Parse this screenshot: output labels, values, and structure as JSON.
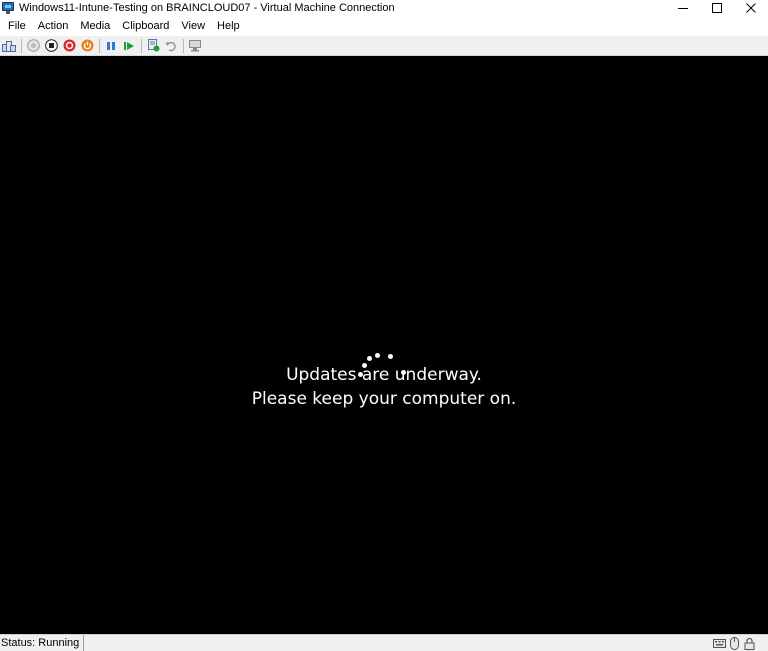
{
  "window": {
    "title": "Windows11-Intune-Testing on BRAINCLOUD07 - Virtual Machine Connection"
  },
  "menu": {
    "items": [
      "File",
      "Action",
      "Media",
      "Clipboard",
      "View",
      "Help"
    ]
  },
  "toolbar": {
    "icons": [
      "ctrl-alt-del-icon",
      "start-icon",
      "turn-off-icon",
      "shut-down-icon",
      "save-icon",
      "pause-icon",
      "resume-icon",
      "checkpoint-icon",
      "revert-icon",
      "enhanced-session-icon"
    ]
  },
  "vm": {
    "message_line1": "Updates are underway.",
    "message_line2": "Please keep your computer on."
  },
  "status": {
    "text": "Status: Running"
  },
  "colors": {
    "vm_background": "#000000",
    "message_text": "#ffffff",
    "shutdown_red": "#d9262c",
    "save_orange": "#e8811b",
    "pause_blue": "#2a7ad4",
    "resume_green": "#1e9e3a"
  }
}
